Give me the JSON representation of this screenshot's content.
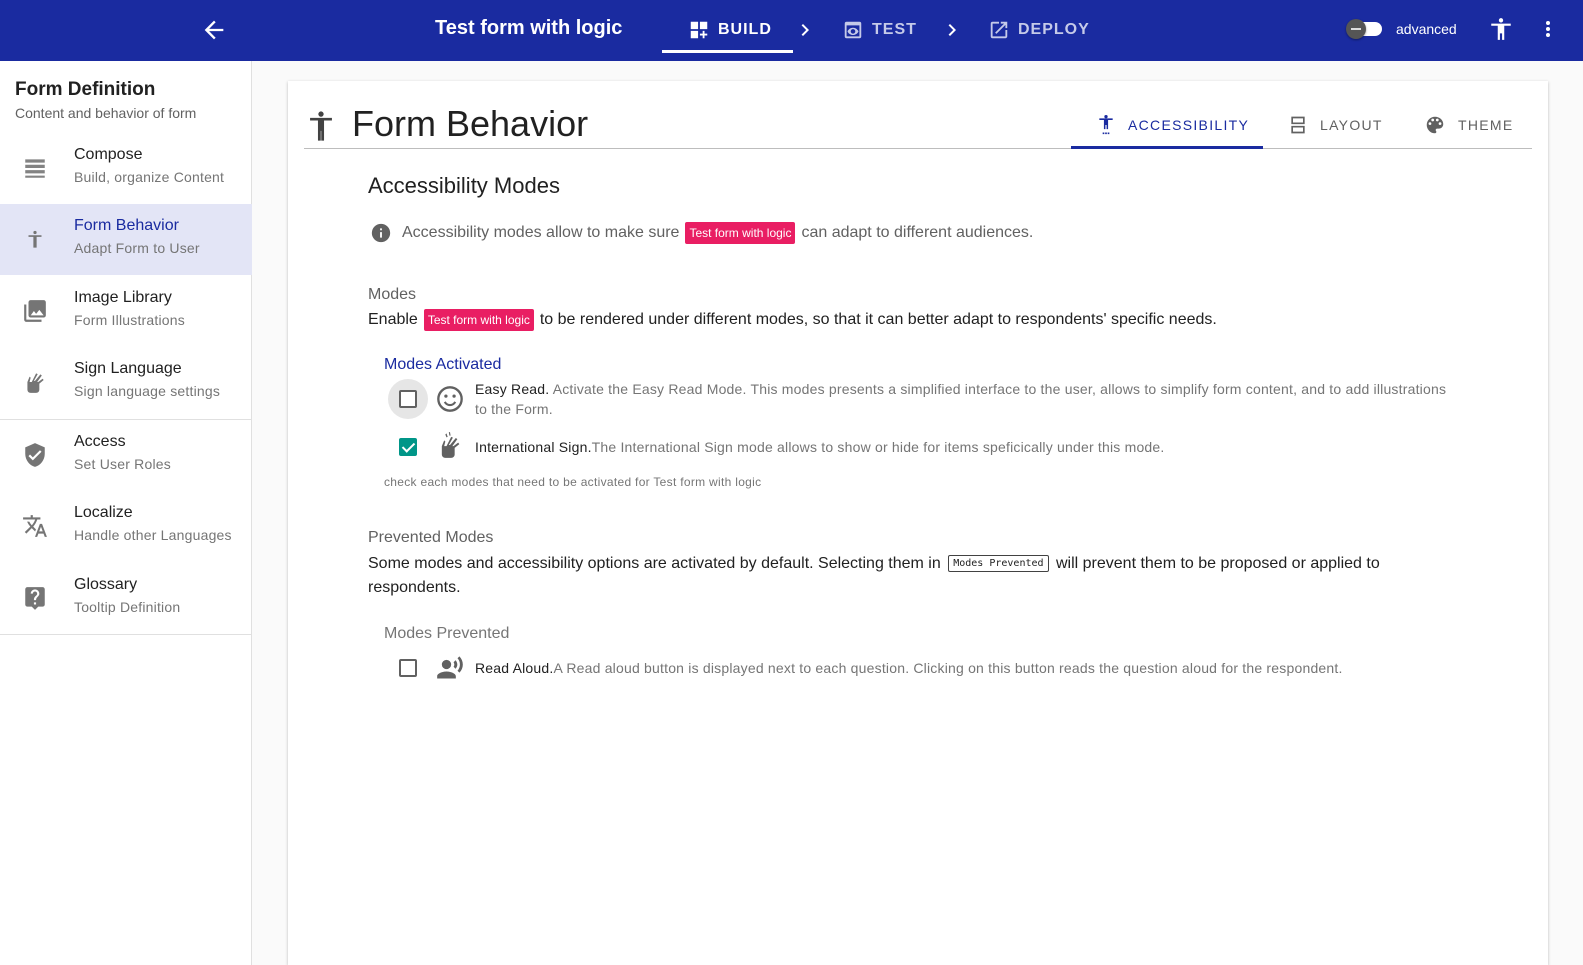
{
  "header": {
    "title": "Test form with logic",
    "steps": [
      {
        "label": "BUILD"
      },
      {
        "label": "TEST"
      },
      {
        "label": "DEPLOY"
      }
    ],
    "advanced_label": "advanced",
    "advanced_on": false
  },
  "sidebar": {
    "title": "Form Definition",
    "subtitle": "Content and behavior of form",
    "items": [
      {
        "label": "Compose",
        "sub": "Build, organize Content",
        "icon": "compose-icon"
      },
      {
        "label": "Form Behavior",
        "sub": "Adapt Form to User",
        "icon": "accessibility-icon",
        "active": true
      },
      {
        "label": "Image Library",
        "sub": "Form Illustrations",
        "icon": "image-library-icon"
      },
      {
        "label": "Sign Language",
        "sub": "Sign language settings",
        "icon": "sign-language-icon"
      },
      {
        "label": "Access",
        "sub": "Set User Roles",
        "icon": "shield-check-icon"
      },
      {
        "label": "Localize",
        "sub": "Handle other Languages",
        "icon": "translate-icon"
      },
      {
        "label": "Glossary",
        "sub": "Tooltip Definition",
        "icon": "help-icon"
      }
    ]
  },
  "main": {
    "title": "Form Behavior",
    "tabs": [
      {
        "label": "ACCESSIBILITY",
        "active": true
      },
      {
        "label": "LAYOUT"
      },
      {
        "label": "THEME"
      }
    ],
    "section_title": "Accessibility Modes",
    "info_prefix": "Accessibility modes allow to make sure",
    "form_chip": "Test form with logic",
    "info_suffix": "can adapt to different audiences.",
    "modes_heading": "Modes",
    "modes_desc_prefix": "Enable",
    "modes_desc_suffix": "to be rendered under different modes, so that it can better adapt to respondents' specific needs.",
    "modes_activated_label": "Modes Activated",
    "modes_activated": [
      {
        "name": "Easy Read.",
        "desc": " Activate the Easy Read Mode. This modes presents a simplified interface to the user, allows to simplify form content, and to add illustrations to the Form.",
        "checked": false
      },
      {
        "name": "International Sign.",
        "desc": "The International Sign mode allows to show or hide for items speficically under this mode.",
        "checked": true
      }
    ],
    "modes_helper": "check each modes that need to be activated for Test form with logic",
    "prevented_heading": "Prevented Modes",
    "prevented_desc_prefix": "Some modes and accessibility options are activated by default. Selecting them in",
    "prevented_code": "Modes Prevented",
    "prevented_desc_suffix": "will prevent them to be proposed or applied to respondents.",
    "modes_prevented_label": "Modes Prevented",
    "modes_prevented": [
      {
        "name": "Read Aloud.",
        "desc": "A Read aloud button is displayed next to each question. Clicking on this button reads the question aloud for the respondent.",
        "checked": false
      }
    ]
  },
  "colors": {
    "primary": "#1a2ba0",
    "chip": "#e91e63",
    "checkbox_checked": "#009688",
    "annotation_arrow": "#e53935"
  }
}
